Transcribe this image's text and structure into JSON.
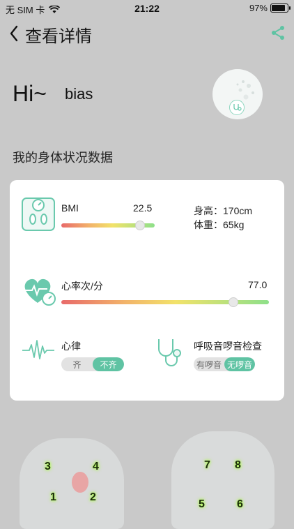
{
  "status_bar": {
    "carrier": "无 SIM 卡",
    "time": "21:22",
    "battery_pct": "97%",
    "battery_level": 0.97
  },
  "nav": {
    "title": "查看详情"
  },
  "greeting": {
    "hi": "Hi~",
    "name": "bias"
  },
  "section_title": "我的身体状况数据",
  "bmi": {
    "label": "BMI",
    "value": "22.5",
    "slider_fraction": 0.84
  },
  "body_info": {
    "height": "身高：170cm",
    "weight": "体重：65kg"
  },
  "heart_rate": {
    "label": "心率次/分",
    "value": "77.0",
    "slider_fraction": 0.83
  },
  "rhythm": {
    "label": "心律",
    "options": [
      "齐",
      "不齐"
    ],
    "selected": "不齐"
  },
  "breath": {
    "label": "呼吸音啰音检查",
    "options": [
      "有啰音",
      "无啰音"
    ],
    "selected": "无啰音"
  },
  "points": {
    "p1": "1",
    "p2": "2",
    "p3": "3",
    "p4": "4",
    "p5": "5",
    "p6": "6",
    "p7": "7",
    "p8": "8"
  },
  "colors": {
    "accent": "#5fc3a3",
    "background": "#c9c9c9",
    "card": "#ffffff"
  }
}
